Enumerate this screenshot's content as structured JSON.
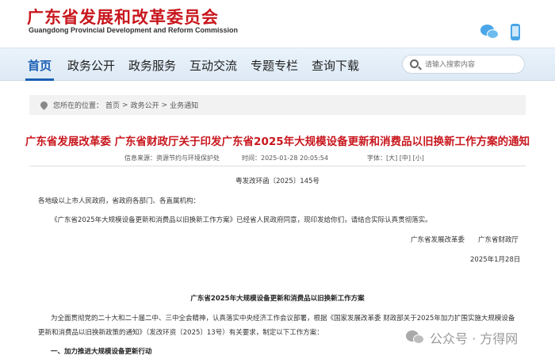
{
  "header": {
    "title_cn": "广东省发展和改革委员会",
    "title_en": "Guangdong Provincial Development and Reform Commission",
    "icons": [
      "wechat-icon",
      "mobile-icon"
    ]
  },
  "nav": {
    "items": [
      "首页",
      "政务公开",
      "政务服务",
      "互动交流",
      "专题专栏",
      "查询下载"
    ],
    "active_index": 0
  },
  "search": {
    "placeholder": "请输入搜索内容"
  },
  "breadcrumb": {
    "prefix": "您所在的位置：",
    "items": [
      "首页",
      "政务公开",
      "业务通知"
    ],
    "separator": ">"
  },
  "article": {
    "title": "广东省发展改革委 广东省财政厅关于印发广东省2025年大规模设备更新和消费品以旧换新工作方案的通知",
    "source": "信息来源：资源节约与环境保护处",
    "date": "时间：2025-01-28 20:05:54",
    "font_size_label": "字体：[大] [中] [小]",
    "doc_no": "粤发改环函〔2025〕145号",
    "greeting": "各地级以上市人民政府，省政府各部门、各直属机构：",
    "body": "《广东省2025年大规模设备更新和消费品以旧换新工作方案》已经省人民政府同意，现印发给你们，请结合实际认真贯彻落实。",
    "signature": "广东省发展改革委　　广东省财政厅",
    "sign_date": "2025年1月28日",
    "plan_title": "广东省2025年大规模设备更新和消费品以旧换新工作方案",
    "plan_para_1": "为全面贯彻党的二十大和二十届二中、三中全会精神，认真落实中央经济工作会议部署，根据《国家发展改革委 财政部关于2025年加力扩围实施大规模设备",
    "plan_para_2": "更新和消费品以旧换新政策的通知》（发改环资〔2025〕13号）有关要求，制定以下工作方案：",
    "section_1": "一、加力推进大规模设备更新行动"
  },
  "watermark": {
    "text": "公众号 · 方得网"
  }
}
